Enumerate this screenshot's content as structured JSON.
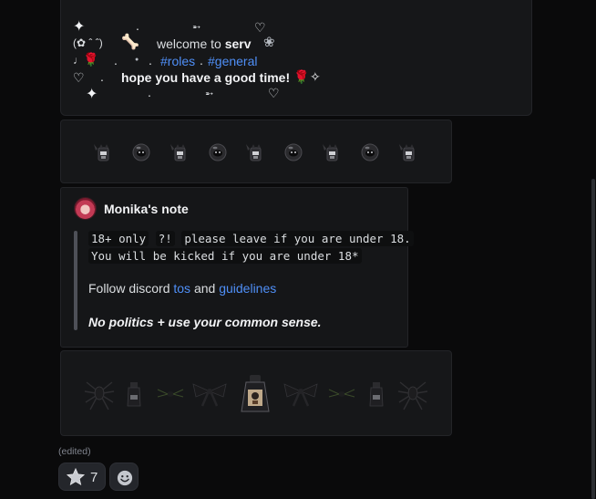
{
  "welcome": {
    "sparkle": "✦",
    "dot": ".",
    "arrow": "➵",
    "heart": "♡",
    "kaomoji": "(✿ ˆ ˆ)",
    "bone": "🦴",
    "welcome_text": "welcome to",
    "server_name": "serv",
    "flower": "❀",
    "note": "♩",
    "rose": "🌹",
    "bullet": "●",
    "roles_channel": "#roles",
    "general_channel": "#general",
    "hope_text": "hope you have a good time!",
    "star_outline": "✧"
  },
  "note": {
    "author": "Monika's note",
    "line1_a": "18+ only",
    "line1_b": "?!",
    "line1_c": "please leave if you are under 18.",
    "line2": "You will be kicked if you are under 18*",
    "follow_prefix": "Follow discord",
    "tos_link": "tos",
    "and_text": "and",
    "guidelines_link": "guidelines",
    "rule": "No politics + use your common sense."
  },
  "footer": {
    "edited": "(edited)",
    "reaction_emoji": "star-icon",
    "reaction_count": "7",
    "add_reaction": "smile-icon"
  },
  "colors": {
    "link": "#4f8ff7",
    "card_bg": "#161719",
    "page_bg": "#0a0a0b"
  }
}
